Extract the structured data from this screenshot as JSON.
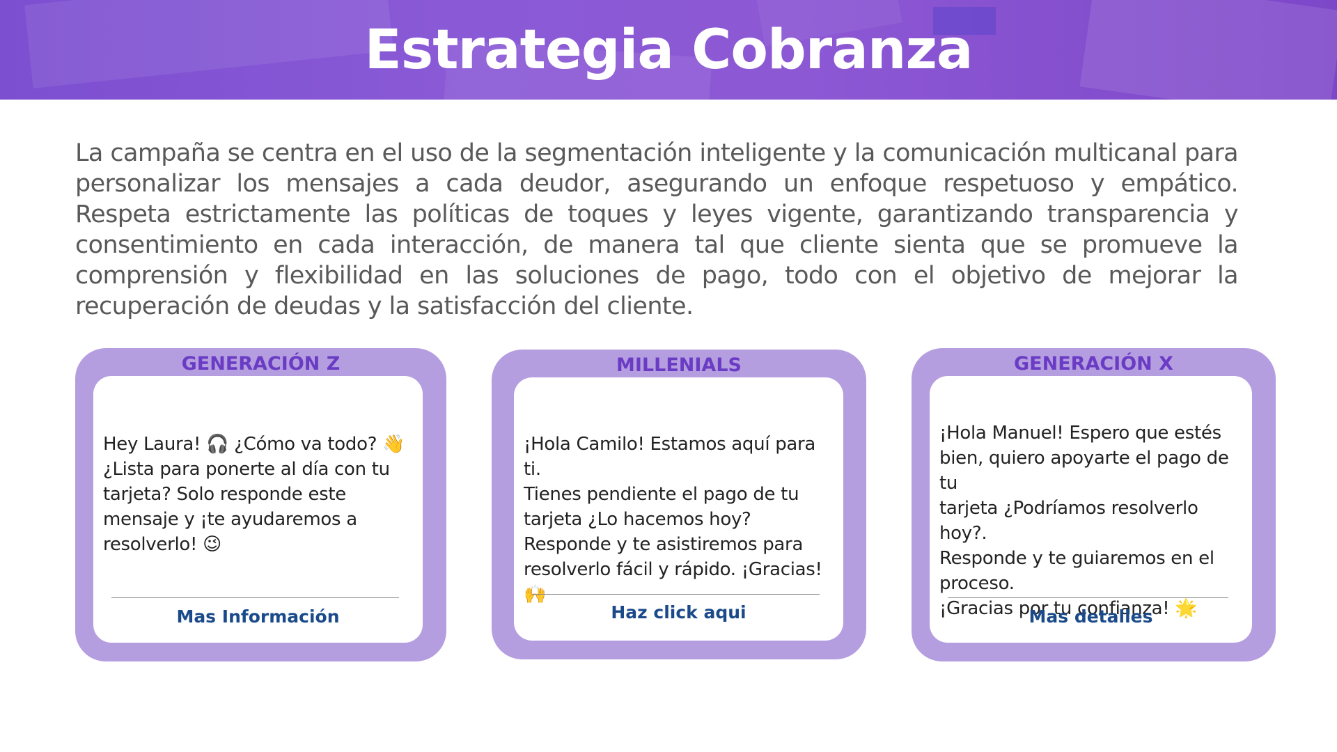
{
  "header": {
    "title": "Estrategia Cobranza"
  },
  "intro": "La campaña se centra en el uso de la segmentación inteligente y la comunicación multicanal para personalizar los mensajes a cada deudor, asegurando un enfoque respetuoso y empático.  Respeta estrictamente las políticas de toques y leyes vigente, garantizando transparencia y consentimiento en cada interacción, de manera tal que cliente sienta que se promueve la comprensión y flexibilidad en las soluciones de pago, todo con el objetivo de mejorar la recuperación de deudas y la satisfacción del cliente.",
  "cards": [
    {
      "title": "GENERACIÓN Z",
      "message": "Hey Laura! 🎧 ¿Cómo va todo? 👋\n¿Lista para ponerte al día con tu\ntarjeta? Solo responde este\nmensaje y ¡te ayudaremos a\nresolverlo! 😉",
      "link": "Mas Información"
    },
    {
      "title": "MILLENIALS",
      "message": "¡Hola Camilo! Estamos aquí para ti.\nTienes pendiente el pago de tu\ntarjeta  ¿Lo hacemos hoy?\nResponde y te asistiremos para\nresolverlo fácil y rápido. ¡Gracias! 🙌",
      "link": "Haz click aqui"
    },
    {
      "title": "GENERACIÓN X",
      "message": "¡Hola Manuel! Espero que estés\nbien, quiero apoyarte el pago de tu\ntarjeta ¿Podríamos resolverlo hoy?.\nResponde y te guiaremos en el\nproceso.\n¡Gracias por tu confianza! 🌟",
      "link": "Mas detalles"
    }
  ],
  "colors": {
    "header_bg": "#8a5ad6",
    "card_frame": "#b59ee0",
    "card_title": "#6a3cc4",
    "link": "#1b4a8a",
    "body_text": "#595959"
  }
}
